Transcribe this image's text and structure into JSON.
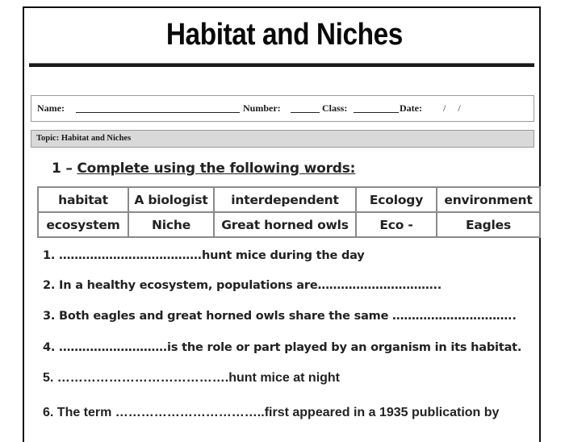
{
  "document": {
    "title": "Habitat and Niches",
    "header": {
      "name_label": "Name:",
      "number_label": "Number:",
      "class_label": "Class:",
      "date_label": "Date:",
      "date_separators": "/     /"
    },
    "topic": "Topic: Habitat and Niches"
  },
  "section1": {
    "number": "1 – ",
    "heading": "Complete using the following words:",
    "word_bank": [
      [
        "habitat",
        "A biologist",
        "interdependent",
        "Ecology",
        "environment"
      ],
      [
        "ecosystem",
        "Niche",
        "Great horned owls",
        "Eco -",
        "Eagles"
      ]
    ],
    "questions": [
      "1. ……………………………….hunt mice during the day",
      "2. In a healthy ecosystem, populations are…………………………..",
      "3. Both eagles and great horned owls share the same …………………………..",
      "4. ……………………….is the role or part played by an organism in its habitat.",
      "5. ………………………………….hunt mice at night",
      "6. The term ……………………………..first appeared in a 1935 publication by"
    ]
  }
}
